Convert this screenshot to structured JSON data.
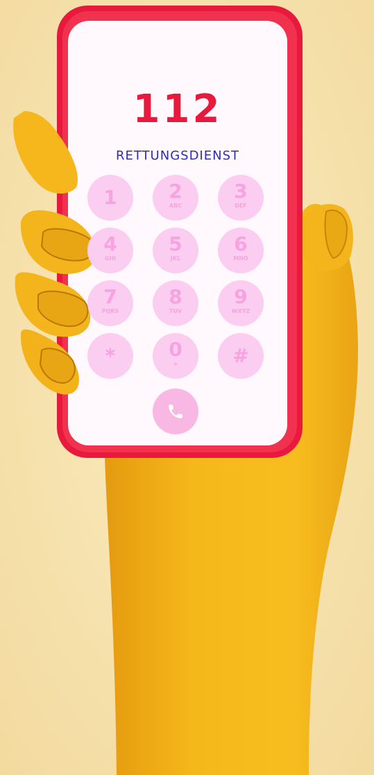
{
  "dialer": {
    "number": "112",
    "service_name": "RETTUNGSDIENST",
    "keys": [
      {
        "digit": "1",
        "letters": ""
      },
      {
        "digit": "2",
        "letters": "ABC"
      },
      {
        "digit": "3",
        "letters": "DEF"
      },
      {
        "digit": "4",
        "letters": "GHI"
      },
      {
        "digit": "5",
        "letters": "JKL"
      },
      {
        "digit": "6",
        "letters": "MNO"
      },
      {
        "digit": "7",
        "letters": "PQRS"
      },
      {
        "digit": "8",
        "letters": "TUV"
      },
      {
        "digit": "9",
        "letters": "WXYZ"
      },
      {
        "digit": "*",
        "letters": ""
      },
      {
        "digit": "0",
        "letters": "+"
      },
      {
        "digit": "#",
        "letters": ""
      }
    ],
    "call_icon": "phone-icon"
  },
  "colors": {
    "background": "#f6e3ad",
    "phone_frame": "#e8193c",
    "screen": "#fff8fc",
    "key": "#fbcdf0",
    "key_text": "#f6a3df",
    "number_text": "#e8193c",
    "service_text": "#2b2fb8",
    "skin": "#f2b81c"
  }
}
